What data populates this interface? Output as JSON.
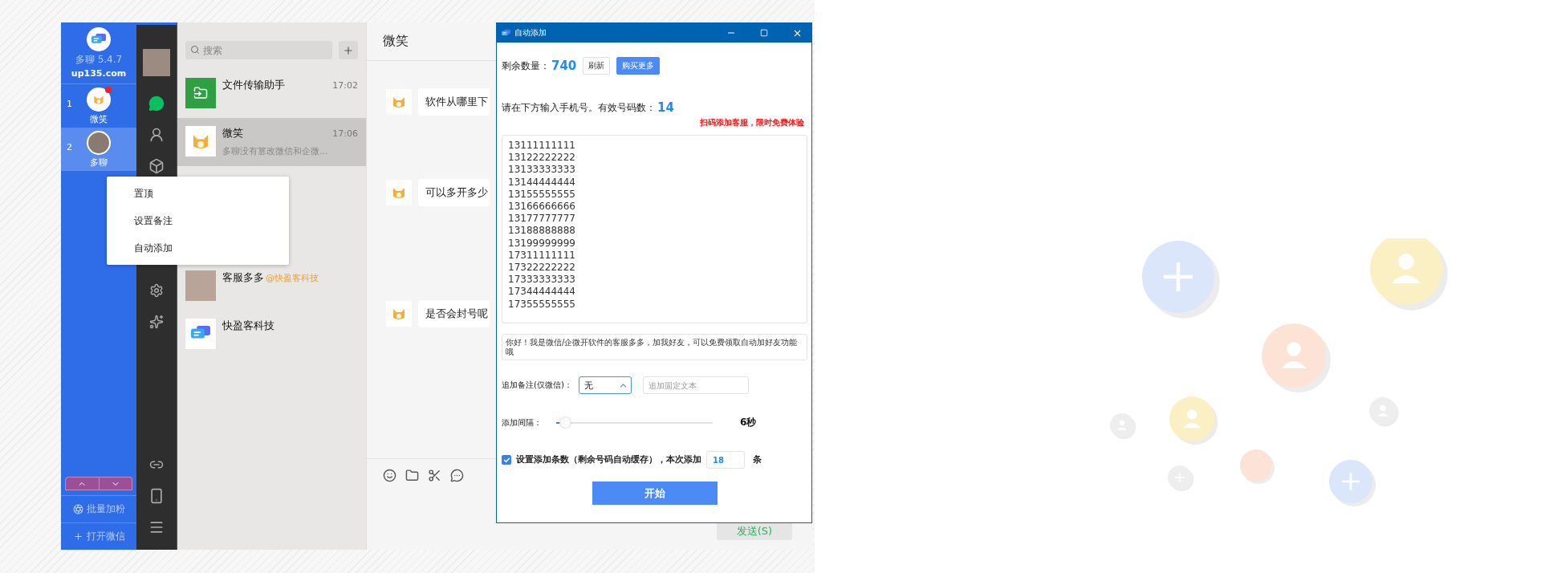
{
  "app": {
    "name": "多聊 5.4.7",
    "site": "up135.com"
  },
  "accounts": [
    {
      "index": "1",
      "name": "微笑",
      "kind": "cat",
      "unread": true,
      "selected": false
    },
    {
      "index": "2",
      "name": "多聊",
      "kind": "photo",
      "unread": false,
      "selected": true
    }
  ],
  "sidebar_actions": [
    {
      "kind": "batch",
      "label": "批量加粉"
    },
    {
      "kind": "open",
      "label": "打开微信"
    }
  ],
  "nav_top": [
    {
      "kind": "chat",
      "selected": true
    },
    {
      "kind": "contacts",
      "selected": false
    },
    {
      "kind": "cube",
      "selected": false
    },
    {
      "kind": "gear",
      "selected": false
    },
    {
      "kind": "spark",
      "selected": false
    }
  ],
  "nav_bottom": [
    {
      "kind": "link"
    },
    {
      "kind": "phone"
    },
    {
      "kind": "menu"
    }
  ],
  "search": {
    "placeholder": "搜索"
  },
  "chats": [
    {
      "name": "文件传输助手",
      "time": "17:02",
      "kind": "file",
      "selected": false
    },
    {
      "name": "微笑",
      "time": "17:06",
      "preview": "多聊没有篡改微信和企微...",
      "kind": "cat",
      "selected": true
    },
    {
      "name": "客服多多",
      "tag": "@快盈客科技",
      "kind": "photo",
      "selected": false
    },
    {
      "name": "快盈客科技",
      "kind": "logo",
      "selected": false
    }
  ],
  "context_menu": [
    "置顶",
    "设置备注",
    "自动添加"
  ],
  "chat": {
    "title": "微笑",
    "messages": [
      "软件从哪里下",
      "可以多开多少",
      "是否会封号呢"
    ],
    "send": "发送(S)"
  },
  "dialog": {
    "title": "自动添加",
    "remaining_label": "剩余数量：",
    "remaining": "740",
    "refresh": "刷新",
    "buy": "购买更多",
    "prompt": "请在下方输入手机号。有效号码数：",
    "valid_count": "14",
    "promo": "扫码添加客服，限时免费体验",
    "numbers": [
      "13111111111",
      "13122222222",
      "13133333333",
      "13144444444",
      "13155555555",
      "13166666666",
      "13177777777",
      "13188888888",
      "13199999999",
      "17311111111",
      "17322222222",
      "17333333333",
      "17344444444",
      "17355555555"
    ],
    "greeting": "你好！我是微信/企微开软件的客服多多，加我好友，可以免费领取自动加好友功能哦",
    "remark_label": "追加备注(仅微信)：",
    "remark_select": {
      "value": "无",
      "expanded": true
    },
    "remark_text": {
      "placeholder": "追加固定文本"
    },
    "interval_label": "添加间隔：",
    "interval": {
      "level": 0.02
    },
    "interval_value": "6秒",
    "limit": {
      "checked": true,
      "label": "设置添加条数（剩余号码自动缓存），本次添加",
      "value": "18",
      "unit": "条"
    },
    "start": "开始"
  }
}
